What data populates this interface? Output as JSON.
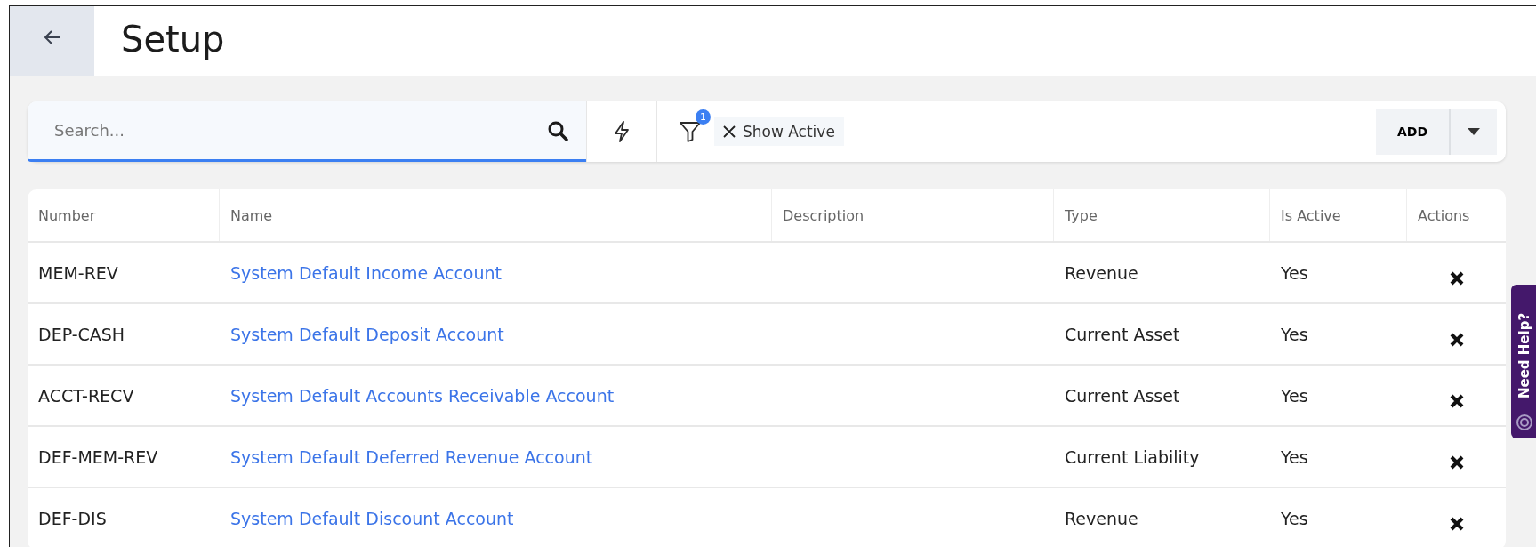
{
  "header": {
    "title": "Setup"
  },
  "toolbar": {
    "search": {
      "placeholder": "Search..."
    },
    "filter_count": "1",
    "chips": [
      {
        "label": "Show Active"
      }
    ],
    "add_button": "ADD"
  },
  "table": {
    "columns": [
      "Number",
      "Name",
      "Description",
      "Type",
      "Is Active",
      "Actions"
    ],
    "rows": [
      {
        "number": "MEM-REV",
        "name": "System Default Income Account",
        "description": "",
        "type": "Revenue",
        "is_active": "Yes"
      },
      {
        "number": "DEP-CASH",
        "name": "System Default Deposit Account",
        "description": "",
        "type": "Current Asset",
        "is_active": "Yes"
      },
      {
        "number": "ACCT-RECV",
        "name": "System Default Accounts Receivable Account",
        "description": "",
        "type": "Current Asset",
        "is_active": "Yes"
      },
      {
        "number": "DEF-MEM-REV",
        "name": "System Default Deferred Revenue Account",
        "description": "",
        "type": "Current Liability",
        "is_active": "Yes"
      },
      {
        "number": "DEF-DIS",
        "name": "System Default Discount Account",
        "description": "",
        "type": "Revenue",
        "is_active": "Yes"
      }
    ]
  },
  "help_tab": {
    "label": "Need Help?"
  }
}
